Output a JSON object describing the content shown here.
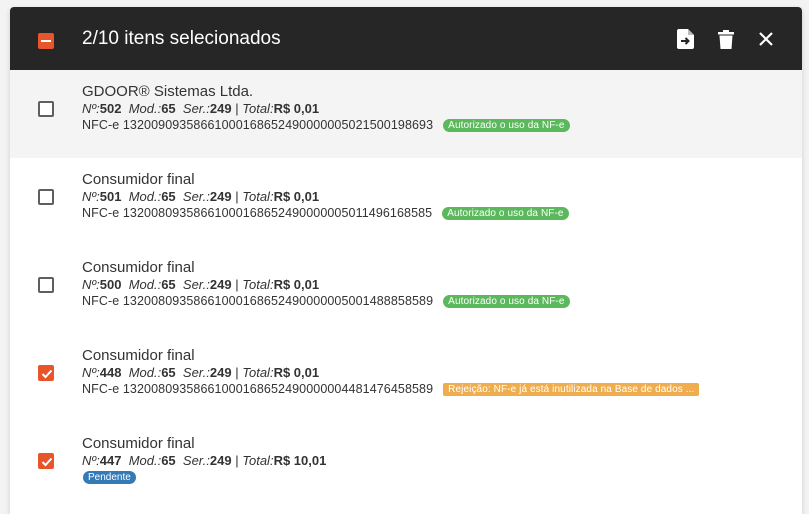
{
  "header": {
    "title": "2/10 itens selecionados",
    "accent_color": "#e8552a",
    "bar_color": "#262626"
  },
  "labels": {
    "num": "Nº:",
    "mod": "Mod.:",
    "ser": "Ser.:",
    "total": "Total:",
    "sep": "|"
  },
  "items": [
    {
      "name": "GDOOR® Sistemas Ltda.",
      "num": "502",
      "mod": "65",
      "ser": "249",
      "total": "R$ 0,01",
      "key": "NFC-e 13200909358661000168652490000005021500198693",
      "status": "Autorizado o uso da NF-e",
      "checked": false
    },
    {
      "name": "Consumidor final",
      "num": "501",
      "mod": "65",
      "ser": "249",
      "total": "R$ 0,01",
      "key": "NFC-e 13200809358661000168652490000005011496168585",
      "status": "Autorizado o uso da NF-e",
      "checked": false
    },
    {
      "name": "Consumidor final",
      "num": "500",
      "mod": "65",
      "ser": "249",
      "total": "R$ 0,01",
      "key": "NFC-e 13200809358661000168652490000005001488858589",
      "status": "Autorizado o uso da NF-e",
      "checked": false
    },
    {
      "name": "Consumidor final",
      "num": "448",
      "mod": "65",
      "ser": "249",
      "total": "R$ 0,01",
      "key": "NFC-e 13200809358661000168652490000004481476458589",
      "status": "Rejeição: NF-e já está inutilizada na Base de dados ...",
      "checked": true
    },
    {
      "name": "Consumidor final",
      "num": "447",
      "mod": "65",
      "ser": "249",
      "total": "R$ 10,01",
      "status": "Pendente",
      "checked": true
    }
  ]
}
